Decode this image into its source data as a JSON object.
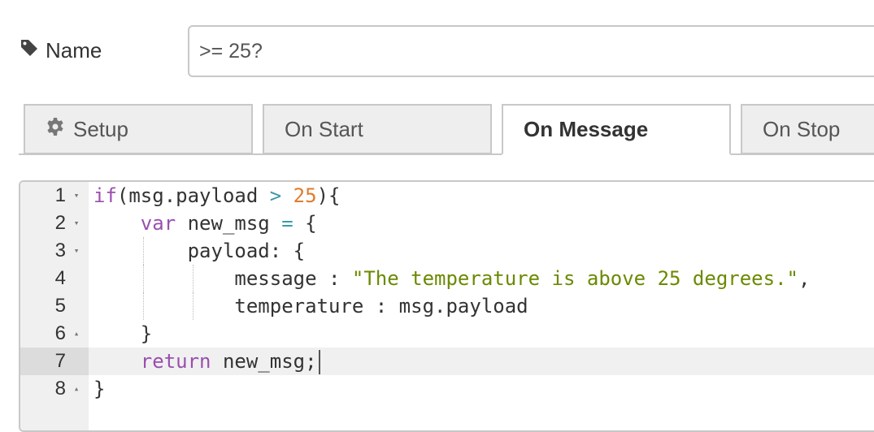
{
  "name_field": {
    "label": "Name",
    "value": ">= 25?"
  },
  "tabs": [
    {
      "label": "Setup",
      "icon": "gear-icon",
      "active": false
    },
    {
      "label": "On Start",
      "active": false
    },
    {
      "label": "On Message",
      "active": true
    },
    {
      "label": "On Stop",
      "active": false
    }
  ],
  "editor": {
    "current_line": 7,
    "lines": [
      {
        "n": "1",
        "fold": "▾",
        "t": [
          "if",
          "(msg.payload ",
          ">",
          " ",
          "25",
          "){"
        ]
      },
      {
        "n": "2",
        "fold": "▾",
        "t": [
          "    ",
          "var",
          " new_msg ",
          "=",
          " {"
        ]
      },
      {
        "n": "3",
        "fold": "▾",
        "t": [
          "        payload: {"
        ]
      },
      {
        "n": "4",
        "fold": "",
        "t": [
          "            message : ",
          "\"The temperature is above 25 degrees.\"",
          ","
        ]
      },
      {
        "n": "5",
        "fold": "",
        "t": [
          "            temperature : msg.payload"
        ]
      },
      {
        "n": "6",
        "fold": "▴",
        "t": [
          "    }"
        ]
      },
      {
        "n": "7",
        "fold": "",
        "t": [
          "    ",
          "return",
          " new_msg;"
        ]
      },
      {
        "n": "8",
        "fold": "▴",
        "t": [
          "}"
        ]
      }
    ]
  },
  "colors": {
    "keyword": "#9a4fb0",
    "number": "#e07b2e",
    "string": "#6a8a00",
    "operator": "#3a9aa6"
  }
}
